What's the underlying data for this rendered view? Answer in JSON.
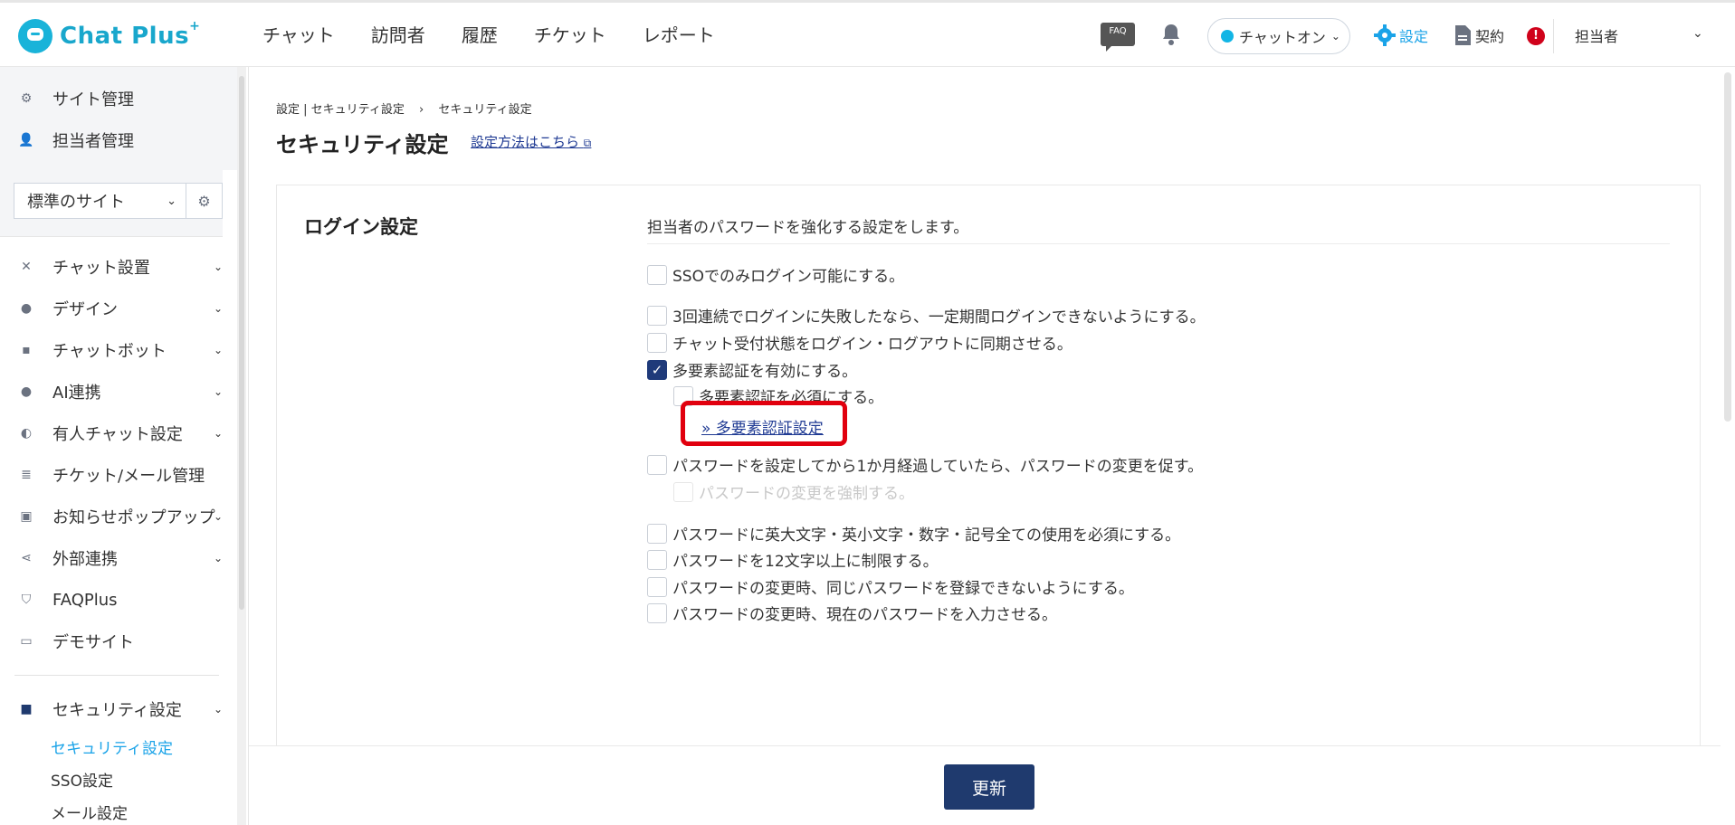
{
  "header": {
    "logo_text": "Chat Plus",
    "logo_sup": "+",
    "nav": [
      "チャット",
      "訪問者",
      "履歴",
      "チケット",
      "レポート"
    ],
    "faq_label": "FAQ",
    "chat_status": "チャットオン",
    "settings_label": "設定",
    "contract_label": "契約",
    "alert_label": "!",
    "user_label": "担当者"
  },
  "sidebar": {
    "top_items": [
      {
        "label": "サイト管理",
        "icon": "gear-icon"
      },
      {
        "label": "担当者管理",
        "icon": "user-gear-icon"
      }
    ],
    "site_select": "標準のサイト",
    "items": [
      {
        "label": "チャット設置",
        "icon": "tools-icon"
      },
      {
        "label": "デザイン",
        "icon": "palette-icon"
      },
      {
        "label": "チャットボット",
        "icon": "chat-bubble-icon"
      },
      {
        "label": "AI連携",
        "icon": "ai-icon"
      },
      {
        "label": "有人チャット設定",
        "icon": "headset-icon"
      },
      {
        "label": "チケット/メール管理",
        "icon": "list-icon"
      },
      {
        "label": "お知らせポップアップ",
        "icon": "popup-icon"
      },
      {
        "label": "外部連携",
        "icon": "share-icon"
      },
      {
        "label": "FAQPlus",
        "icon": "shield-icon"
      },
      {
        "label": "デモサイト",
        "icon": "browser-icon"
      }
    ],
    "security": {
      "label": "セキュリティ設定",
      "icon": "security-icon",
      "sub_items": [
        "セキュリティ設定",
        "SSO設定",
        "メール設定"
      ]
    }
  },
  "content": {
    "breadcrumb": [
      "設定 | セキュリティ設定",
      "セキュリティ設定"
    ],
    "breadcrumb_sep": "›",
    "title": "セキュリティ設定",
    "howto_link": "設定方法はこちら",
    "card": {
      "title": "ログイン設定",
      "description": "担当者のパスワードを強化する設定をします。",
      "options": [
        {
          "label": "SSOでのみログイン可能にする。",
          "checked": false
        },
        {
          "label": "3回連続でログインに失敗したなら、一定期間ログインできないようにする。",
          "checked": false
        },
        {
          "label": "チャット受付状態をログイン・ログアウトに同期させる。",
          "checked": false
        },
        {
          "label": "多要素認証を有効にする。",
          "checked": true
        },
        {
          "label": "多要素認証を必須にする。",
          "checked": false
        },
        {
          "label": "パスワードを設定してから1か月経過していたら、パスワードの変更を促す。",
          "checked": false
        },
        {
          "label": "パスワードの変更を強制する。",
          "checked": false
        },
        {
          "label": "パスワードに英大文字・英小文字・数字・記号全ての使用を必須にする。",
          "checked": false
        },
        {
          "label": "パスワードを12文字以上に制限する。",
          "checked": false
        },
        {
          "label": "パスワードの変更時、同じパスワードを登録できないようにする。",
          "checked": false
        },
        {
          "label": "パスワードの変更時、現在のパスワードを入力させる。",
          "checked": false
        }
      ],
      "mfa_link": "» 多要素認証設定"
    },
    "update_button": "更新"
  },
  "colors": {
    "accent": "#1aa3e8",
    "primary_button": "#1f3a6e",
    "highlight_box": "#e1000e",
    "status_dot": "#12b5e5"
  }
}
